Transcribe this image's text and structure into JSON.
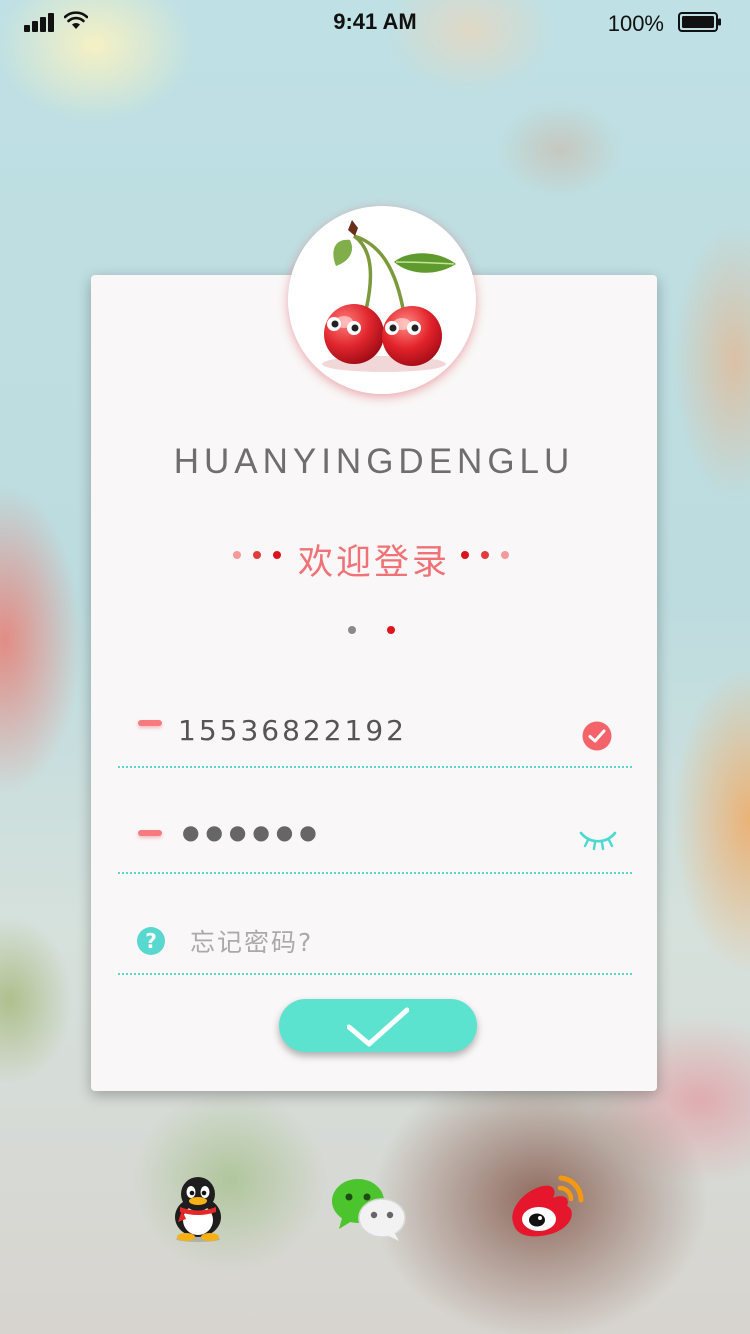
{
  "status_bar": {
    "time": "9:41 AM",
    "battery_percent": "100%",
    "icons": [
      "signal-icon",
      "wifi-icon",
      "battery-icon"
    ]
  },
  "login": {
    "avatar_icon": "cherry-logo",
    "subtitle_en": "HUANYINGDENGLU",
    "welcome": "欢迎登录",
    "page_dots": {
      "count": 2,
      "active_index": 1
    },
    "phone": {
      "value": "15536822192",
      "status_icon": "check-icon"
    },
    "password": {
      "value": "●●●●●●",
      "visibility_icon": "eye-closed-icon"
    },
    "forgot": {
      "icon": "help-icon",
      "icon_glyph": "?",
      "label": "忘记密码?"
    },
    "submit_icon": "checkmark-icon"
  },
  "social_login": [
    "qq-icon",
    "wechat-icon",
    "weibo-icon"
  ],
  "colors": {
    "accent_teal": "#5ce3cf",
    "accent_red": "#f07277",
    "card_bg": "#f9f7f7"
  }
}
